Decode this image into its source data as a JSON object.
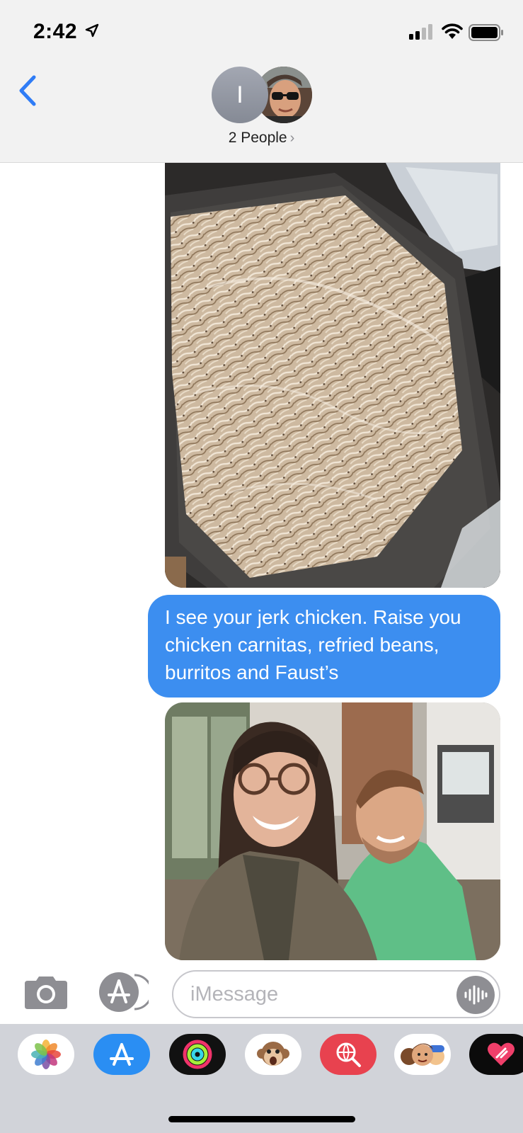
{
  "status_bar": {
    "time": "2:42",
    "location_icon": "location-arrow-icon",
    "signal_icon": "cellular-signal-icon",
    "wifi_icon": "wifi-icon",
    "battery_icon": "battery-icon"
  },
  "header": {
    "back_icon": "chevron-left-icon",
    "avatar_initial": "I",
    "title": "2 People",
    "title_chevron": "›"
  },
  "messages": [
    {
      "type": "photo",
      "from": "me",
      "description_icon": "photo-attachment"
    },
    {
      "type": "text",
      "from": "me",
      "text": "I see your jerk chicken.  Raise you chicken carnitas, refried beans, burritos and Faust’s"
    },
    {
      "type": "photo",
      "from": "me",
      "description_icon": "photo-attachment"
    }
  ],
  "input_bar": {
    "placeholder": "iMessage",
    "camera_icon": "camera-icon",
    "appstore_icon": "app-store-icon",
    "audio_icon": "audio-waveform-icon"
  },
  "app_drawer": {
    "apps": [
      {
        "name": "photos",
        "icon": "photos-icon"
      },
      {
        "name": "app-store",
        "icon": "app-store-icon"
      },
      {
        "name": "activity",
        "icon": "activity-rings-icon"
      },
      {
        "name": "animoji",
        "icon": "monkey-icon"
      },
      {
        "name": "images-search",
        "icon": "globe-search-icon"
      },
      {
        "name": "memoji",
        "icon": "memoji-icon"
      },
      {
        "name": "digital-touch",
        "icon": "heart-icon"
      }
    ]
  },
  "colors": {
    "bubble_blue": "#3c8ef0",
    "ios_blue": "#2f7cf6",
    "header_bg": "#f2f2f2",
    "drawer_bg": "#d1d3d9"
  }
}
